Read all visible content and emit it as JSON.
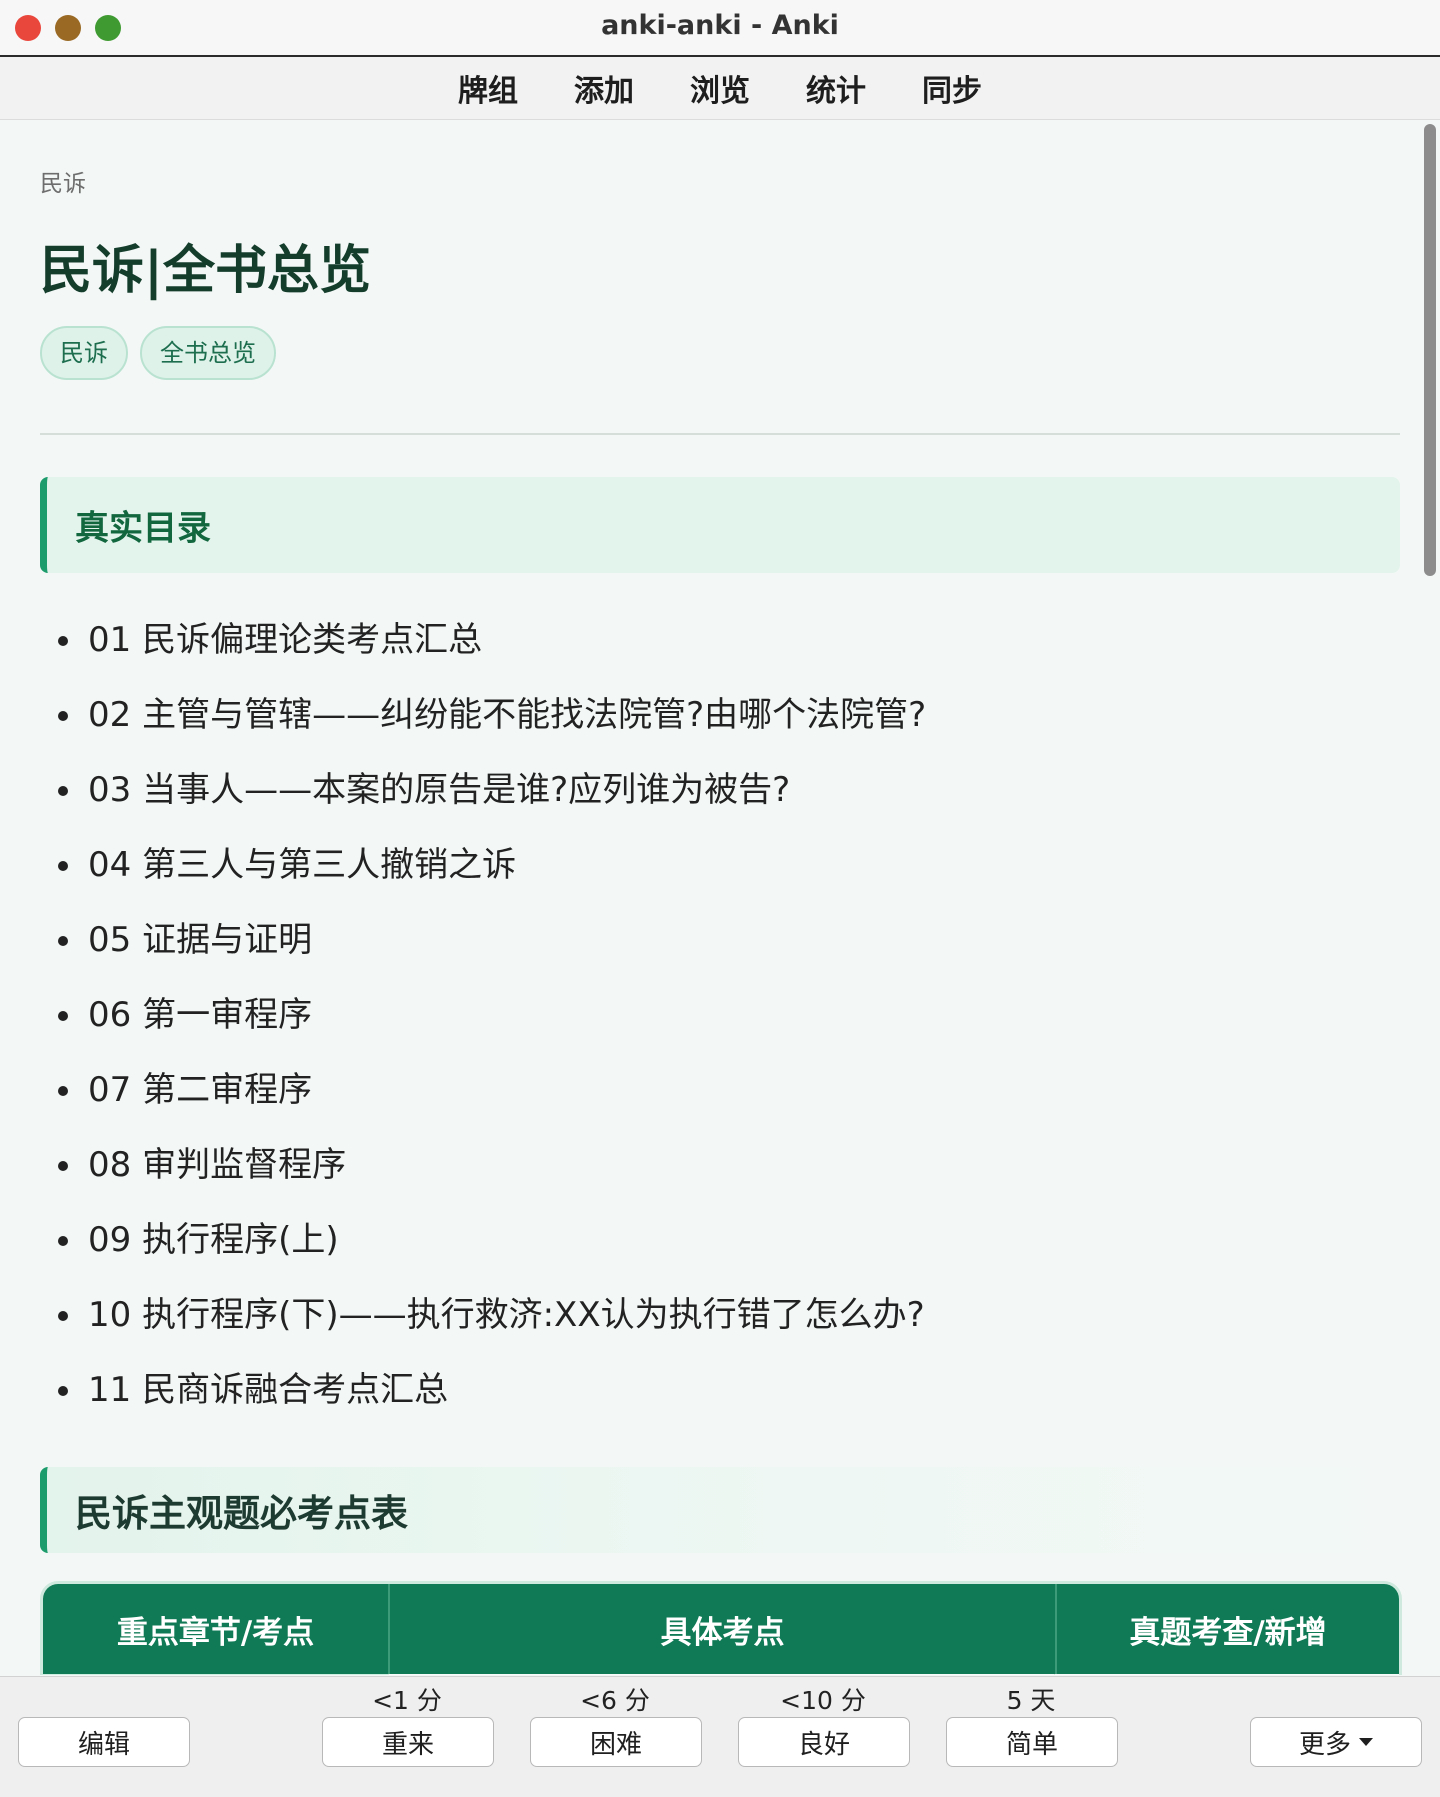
{
  "window": {
    "title": "anki-anki - Anki"
  },
  "toolbar": {
    "items": [
      "牌组",
      "添加",
      "浏览",
      "统计",
      "同步"
    ]
  },
  "card": {
    "breadcrumb": "民诉",
    "title": "民诉|全书总览",
    "tags": [
      "民诉",
      "全书总览"
    ],
    "section1_title": "真实目录",
    "toc": [
      "01 民诉偏理论类考点汇总",
      "02 主管与管辖——纠纷能不能找法院管?由哪个法院管?",
      "03 当事人——本案的原告是谁?应列谁为被告?",
      "04 第三人与第三人撤销之诉",
      "05 证据与证明",
      "06 第一审程序",
      "07 第二审程序",
      "08 审判监督程序",
      "09 执行程序(上)",
      "10 执行程序(下)——执行救济:XX认为执行错了怎么办?",
      "11 民商诉融合考点汇总"
    ],
    "section2_title": "民诉主观题必考点表",
    "table_headers": [
      "重点章节/考点",
      "具体考点",
      "真题考查/新增"
    ]
  },
  "review": {
    "edit_label": "编辑",
    "answers": [
      {
        "interval": "<1 分",
        "label": "重来"
      },
      {
        "interval": "<6 分",
        "label": "困难"
      },
      {
        "interval": "<10 分",
        "label": "良好"
      },
      {
        "interval": "5 天",
        "label": "简单"
      }
    ],
    "more_label": "更多"
  },
  "colors": {
    "accent": "#1c9b6c",
    "table_header": "#0f7a55",
    "title_text": "#143d2c",
    "tag_bg": "#dff2ea"
  }
}
